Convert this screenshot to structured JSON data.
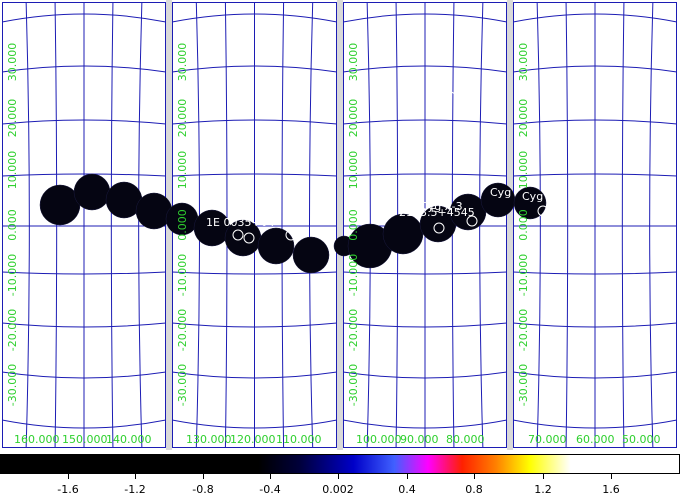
{
  "viewer": {
    "panels": [
      {
        "lon_labels": [
          "160.000",
          "150.000",
          "140.000"
        ]
      },
      {
        "lon_labels": [
          "130.000",
          "120.000",
          "110.000"
        ]
      },
      {
        "lon_labels": [
          "100.000",
          "90.000",
          "80.000"
        ]
      },
      {
        "lon_labels": [
          "70.000",
          "60.000",
          "50.000"
        ]
      }
    ],
    "lat_labels": [
      "30.000",
      "20.000",
      "10.000",
      "0.000",
      "-10.000",
      "-20.000",
      "-30.000"
    ],
    "sources": [
      {
        "label": "1E 0035+64"
      },
      {
        "label": "Cyg X-3"
      },
      {
        "label": "Cyg"
      },
      {
        "label": "Cyg"
      },
      {
        "label": "2103.5+4545"
      }
    ],
    "colors": {
      "grid": "#1c1cb4",
      "labels": "#2fd02f",
      "markers": "#ffffff"
    }
  },
  "colorbar": {
    "ticks": [
      "-1.6",
      "-1.2",
      "-0.8",
      "-0.4",
      "0.002",
      "0.4",
      "0.8",
      "1.2",
      "1.6"
    ],
    "stops": [
      "#000000",
      "#00003a",
      "#0000c8",
      "#4060ff",
      "#ff00ff",
      "#ff2000",
      "#ff8000",
      "#ffff00",
      "#ffffff"
    ]
  }
}
